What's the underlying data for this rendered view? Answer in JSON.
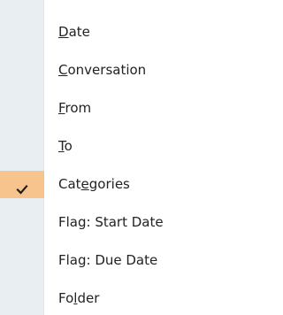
{
  "menu": {
    "items": [
      {
        "before": "",
        "access": "D",
        "after": "ate",
        "checked": false
      },
      {
        "before": "",
        "access": "C",
        "after": "onversation",
        "checked": false
      },
      {
        "before": "",
        "access": "F",
        "after": "rom",
        "checked": false
      },
      {
        "before": "",
        "access": "T",
        "after": "o",
        "checked": false
      },
      {
        "before": "Cat",
        "access": "e",
        "after": "gories",
        "checked": true
      },
      {
        "before": "Flag: Start Date",
        "access": "",
        "after": "",
        "checked": false
      },
      {
        "before": "Flag: Due Date",
        "access": "",
        "after": "",
        "checked": false
      },
      {
        "before": "Fo",
        "access": "l",
        "after": "der",
        "checked": false
      }
    ],
    "check_icon": "check-icon",
    "colors": {
      "gutter": "#e8eef2",
      "selected_highlight": "#f8c48e",
      "text": "#222222"
    }
  }
}
